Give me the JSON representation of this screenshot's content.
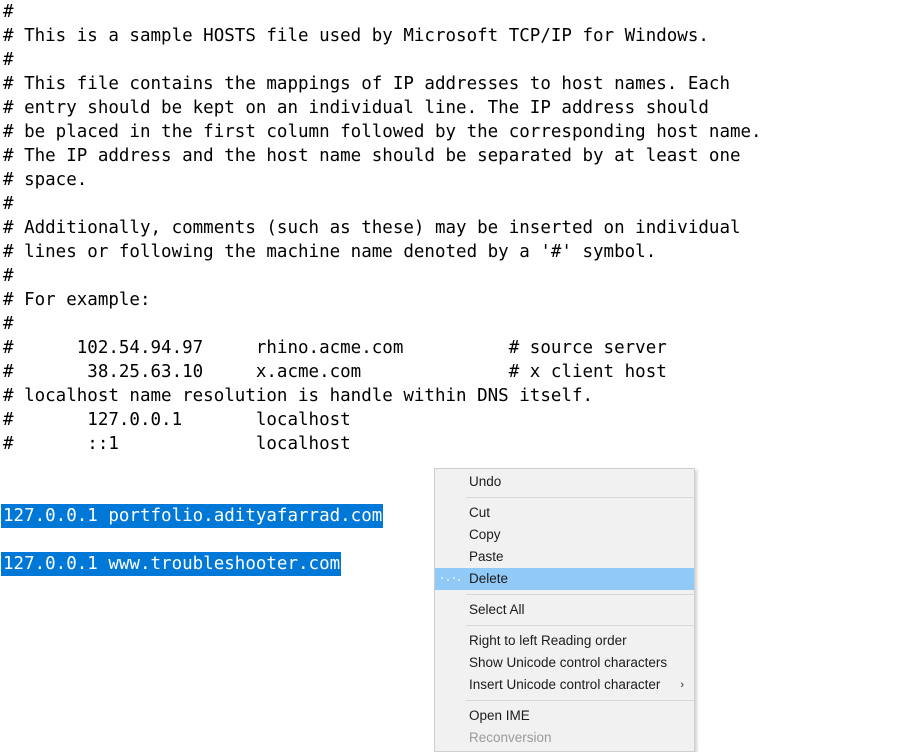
{
  "app": {
    "name": "notepad-hosts-file",
    "window_background": "#ffffff",
    "text_color": "#000000",
    "selection_background": "#0078d7",
    "selection_text_color": "#ffffff",
    "menu_background": "#f1f1f1",
    "menu_highlight": "#91c9f7",
    "menu_border": "#cfcfcf",
    "menu_disabled_text": "#9a9a9a"
  },
  "document": {
    "lines": [
      {
        "text": "#",
        "selected": false
      },
      {
        "text": "# This is a sample HOSTS file used by Microsoft TCP/IP for Windows.",
        "selected": false
      },
      {
        "text": "#",
        "selected": false
      },
      {
        "text": "# This file contains the mappings of IP addresses to host names. Each",
        "selected": false
      },
      {
        "text": "# entry should be kept on an individual line. The IP address should",
        "selected": false
      },
      {
        "text": "# be placed in the first column followed by the corresponding host name.",
        "selected": false
      },
      {
        "text": "# The IP address and the host name should be separated by at least one",
        "selected": false
      },
      {
        "text": "# space.",
        "selected": false
      },
      {
        "text": "#",
        "selected": false
      },
      {
        "text": "# Additionally, comments (such as these) may be inserted on individual",
        "selected": false
      },
      {
        "text": "# lines or following the machine name denoted by a '#' symbol.",
        "selected": false
      },
      {
        "text": "#",
        "selected": false
      },
      {
        "text": "# For example:",
        "selected": false
      },
      {
        "text": "#",
        "selected": false
      },
      {
        "text": "#      102.54.94.97     rhino.acme.com          # source server",
        "selected": false
      },
      {
        "text": "#       38.25.63.10     x.acme.com              # x client host",
        "selected": false
      },
      {
        "text": "# localhost name resolution is handle within DNS itself.",
        "selected": false
      },
      {
        "text": "#       127.0.0.1       localhost",
        "selected": false
      },
      {
        "text": "#       ::1             localhost",
        "selected": false
      },
      {
        "text": "",
        "selected": false
      },
      {
        "text": "",
        "selected": false
      },
      {
        "text": "127.0.0.1 portfolio.adityafarrad.com",
        "selected": true
      },
      {
        "text": "",
        "selected": false
      },
      {
        "text": "127.0.0.1 www.troubleshooter.com",
        "selected": true
      }
    ]
  },
  "context_menu": {
    "items": [
      {
        "label": "Undo",
        "type": "item",
        "state": "normal",
        "submenu": false
      },
      {
        "label": "",
        "type": "separator",
        "state": "normal",
        "submenu": false
      },
      {
        "label": "Cut",
        "type": "item",
        "state": "normal",
        "submenu": false
      },
      {
        "label": "Copy",
        "type": "item",
        "state": "normal",
        "submenu": false
      },
      {
        "label": "Paste",
        "type": "item",
        "state": "normal",
        "submenu": false
      },
      {
        "label": "Delete",
        "type": "item",
        "state": "highlighted",
        "submenu": false
      },
      {
        "label": "",
        "type": "separator",
        "state": "normal",
        "submenu": false
      },
      {
        "label": "Select All",
        "type": "item",
        "state": "normal",
        "submenu": false
      },
      {
        "label": "",
        "type": "separator",
        "state": "normal",
        "submenu": false
      },
      {
        "label": "Right to left Reading order",
        "type": "item",
        "state": "normal",
        "submenu": false
      },
      {
        "label": "Show Unicode control characters",
        "type": "item",
        "state": "normal",
        "submenu": false
      },
      {
        "label": "Insert Unicode control character",
        "type": "item",
        "state": "normal",
        "submenu": true
      },
      {
        "label": "",
        "type": "separator",
        "state": "normal",
        "submenu": false
      },
      {
        "label": "Open IME",
        "type": "item",
        "state": "normal",
        "submenu": false
      },
      {
        "label": "Reconversion",
        "type": "item",
        "state": "disabled",
        "submenu": false
      }
    ],
    "submenu_arrow_glyph": "›"
  }
}
